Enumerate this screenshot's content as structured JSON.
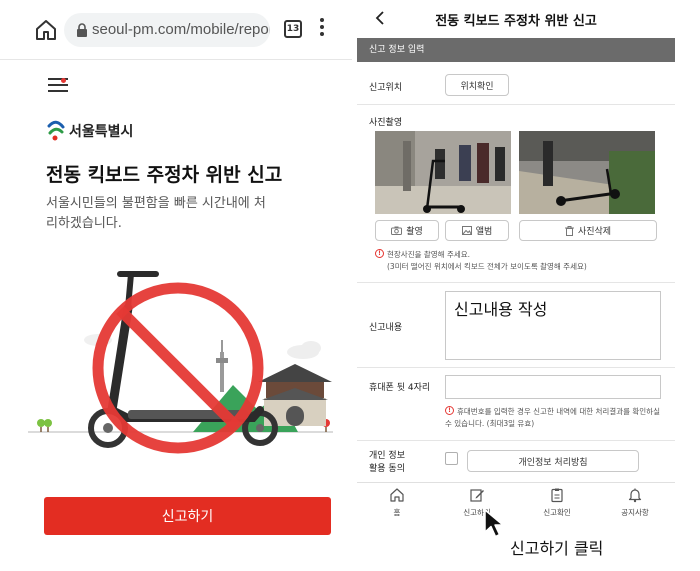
{
  "browser": {
    "url": "seoul-pm.com/mobile/report",
    "tab_count": "13"
  },
  "left": {
    "logo_text": "서울특별시",
    "title": "전동 킥보드 주정차 위반 신고",
    "subtitle": "서울시민들의 불편함을 빠른 시간내에 처리하겠습니다.",
    "report_button": "신고하기"
  },
  "right": {
    "title": "전동 킥보드 주정차 위반 신고",
    "section": "신고 정보 입력",
    "location_label": "신고위치",
    "location_button": "위치확인",
    "photo_label": "사진촬영",
    "camera_button": "촬영",
    "album_button": "앨범",
    "delete_button": "사진삭제",
    "photo_notice_1": "현장사진을 촬영해 주세요.",
    "photo_notice_2": "(3미터 떨어진 위치에서 킥보드 전체가 보이도록 촬영해 주세요)",
    "content_label": "신고내용",
    "content_value": "신고내용 작성",
    "phone_label": "휴대폰 뒷 4자리",
    "phone_notice": "휴대번호를 입력한 경우 신고한 내역에 대한 처리결과를 확인하실 수 있습니다. (최대3일 유효)",
    "consent_label_1": "개인 정보",
    "consent_label_2": "활용 동의",
    "privacy_button": "개인정보 처리방침"
  },
  "nav": [
    {
      "label": "홈",
      "icon": "home-icon"
    },
    {
      "label": "신고하기",
      "icon": "edit-icon"
    },
    {
      "label": "신고확인",
      "icon": "clipboard-icon"
    },
    {
      "label": "공지사항",
      "icon": "bell-icon"
    }
  ],
  "caption": "신고하기 클릭",
  "colors": {
    "accent_red": "#e32d22",
    "section_gray": "#6b6b6b",
    "seoul_blue": "#1b5fae",
    "seoul_green": "#2e9b47"
  }
}
